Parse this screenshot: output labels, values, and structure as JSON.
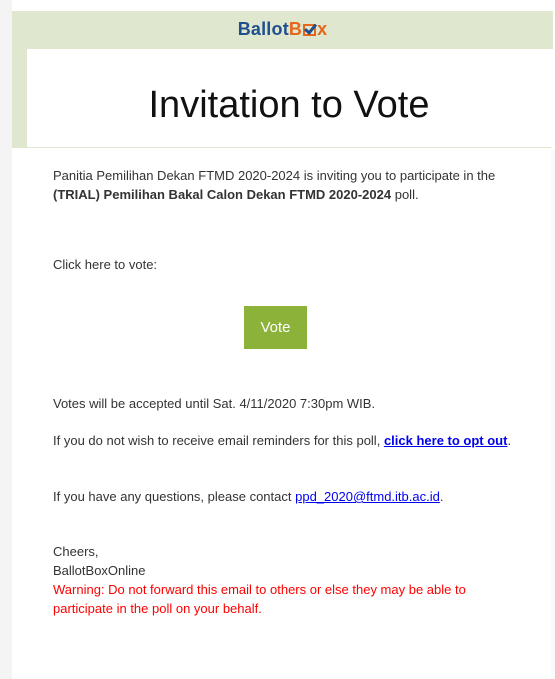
{
  "brand": {
    "part1": "Ballot",
    "part2_b": "B",
    "part2_rest": "x",
    "icon": "checkbox-check-icon",
    "colors": {
      "blue": "#1f4f8f",
      "orange": "#e8661b",
      "bar": "#dfe7cf"
    }
  },
  "hero": {
    "title": "Invitation to Vote"
  },
  "intro": {
    "text_start": "Panitia Pemilihan Dekan FTMD 2020-2024 is inviting you to participate in the ",
    "poll_name": "(TRIAL) Pemilihan Bakal Calon Dekan FTMD 2020-2024",
    "text_end": " poll."
  },
  "click_prompt": "Click here to vote:",
  "vote_button": {
    "label": "Vote",
    "color": "#8db23a"
  },
  "deadline": "Votes will be accepted until Sat. 4/11/2020 7:30pm WIB.",
  "optout": {
    "text": "If you do not wish to receive email reminders for this poll, ",
    "link_label": "click here to opt out",
    "after": "."
  },
  "contact": {
    "text": "If you have any questions, please contact ",
    "email": "ppd_2020@ftmd.itb.ac.id",
    "after": "."
  },
  "signoff": {
    "line1": "Cheers,",
    "line2": "BallotBoxOnline"
  },
  "warning": {
    "text": "Warning: Do not forward this email to others or else they may be able to participate in the poll on your behalf.",
    "color": "#ff0000"
  }
}
